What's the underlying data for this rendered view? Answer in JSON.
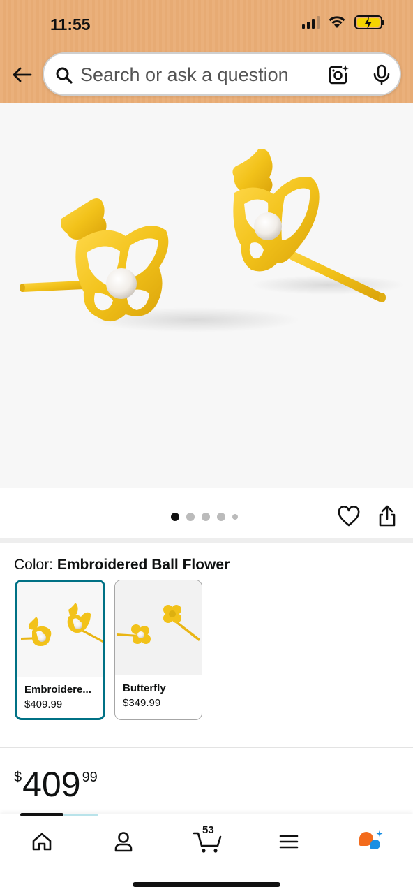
{
  "status_bar": {
    "time": "11:55"
  },
  "search": {
    "placeholder": "Search or ask a question"
  },
  "gallery": {
    "image_count": 5,
    "active_index": 0
  },
  "color": {
    "label": "Color: ",
    "selected_value": "Embroidered Ball Flower",
    "options": [
      {
        "name": "Embroidere...",
        "price": "$409.99",
        "selected": true
      },
      {
        "name": "Butterfly",
        "price": "$349.99",
        "selected": false
      }
    ]
  },
  "price": {
    "currency": "$",
    "whole": "409",
    "fraction": "99"
  },
  "bottom_nav": {
    "cart_count": "53"
  },
  "colors": {
    "header_bg": "#e9ae78",
    "accent_teal": "#007185",
    "gold": "#f2c21a",
    "rufus_orange": "#f36b1c",
    "rufus_blue": "#1a8fe3"
  }
}
